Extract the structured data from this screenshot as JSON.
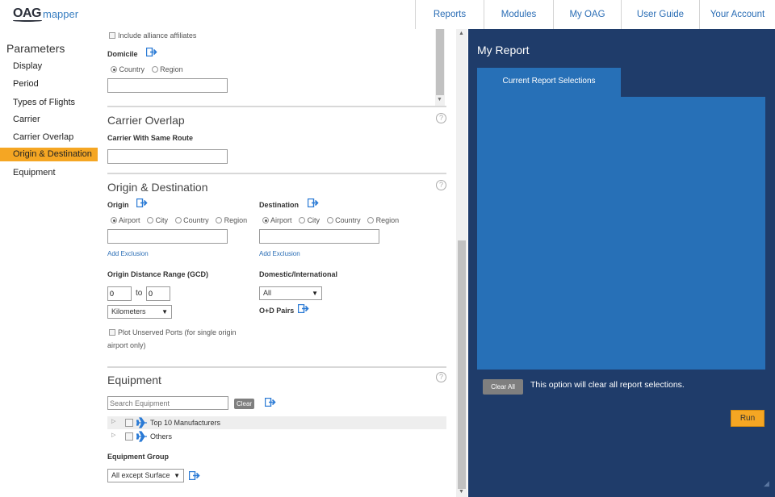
{
  "logo": {
    "oag": "OAG",
    "mapper": "mapper"
  },
  "nav": {
    "reports": "Reports",
    "modules": "Modules",
    "my_oag": "My OAG",
    "user_guide": "User Guide",
    "your_account": "Your Account"
  },
  "sidebar": {
    "title": "Parameters",
    "items": [
      {
        "label": "Display"
      },
      {
        "label": "Period"
      },
      {
        "label": "Types of Flights"
      },
      {
        "label": "Carrier"
      },
      {
        "label": "Carrier Overlap"
      },
      {
        "label": "Origin & Destination",
        "active": true
      },
      {
        "label": "Equipment"
      }
    ]
  },
  "carrier": {
    "include_alliance": "Include alliance affiliates",
    "domicile_label": "Domicile",
    "domicile_options": [
      "Country",
      "Region"
    ],
    "domicile_value": ""
  },
  "carrier_overlap": {
    "title": "Carrier Overlap",
    "same_route_label": "Carrier With Same Route",
    "same_route_value": ""
  },
  "od": {
    "title": "Origin & Destination",
    "origin_label": "Origin",
    "destination_label": "Destination",
    "origin_options": [
      "Airport",
      "City",
      "Country",
      "Region"
    ],
    "destination_options": [
      "Airport",
      "City",
      "Country",
      "Region"
    ],
    "origin_value": "",
    "destination_value": "",
    "add_exclusion": "Add Exclusion",
    "distance_label": "Origin Distance Range (GCD)",
    "distance_from": "0",
    "distance_to_label": "to",
    "distance_to": "0",
    "distance_unit": "Kilometers",
    "domestic_label": "Domestic/International",
    "domestic_value": "All",
    "od_pairs_label": "O+D Pairs",
    "plot_unserved": "Plot Unserved Ports (for single origin",
    "plot_unserved_2": "airport only)"
  },
  "equipment": {
    "title": "Equipment",
    "search_placeholder": "Search Equipment",
    "clear_label": "Clear",
    "tree": [
      {
        "label": "Top 10 Manufacturers"
      },
      {
        "label": "Others"
      }
    ],
    "group_label": "Equipment Group",
    "group_value": "All except Surface"
  },
  "report": {
    "title": "My Report",
    "tab_label": "Current Report Selections",
    "clear_all_label": "Clear All",
    "clear_all_text": "This option will clear all report selections.",
    "run_label": "Run"
  },
  "colors": {
    "accent": "#f5a623",
    "nav_link": "#2a6db5",
    "report_bg": "#1f3c6a",
    "report_tab": "#2770b7"
  }
}
